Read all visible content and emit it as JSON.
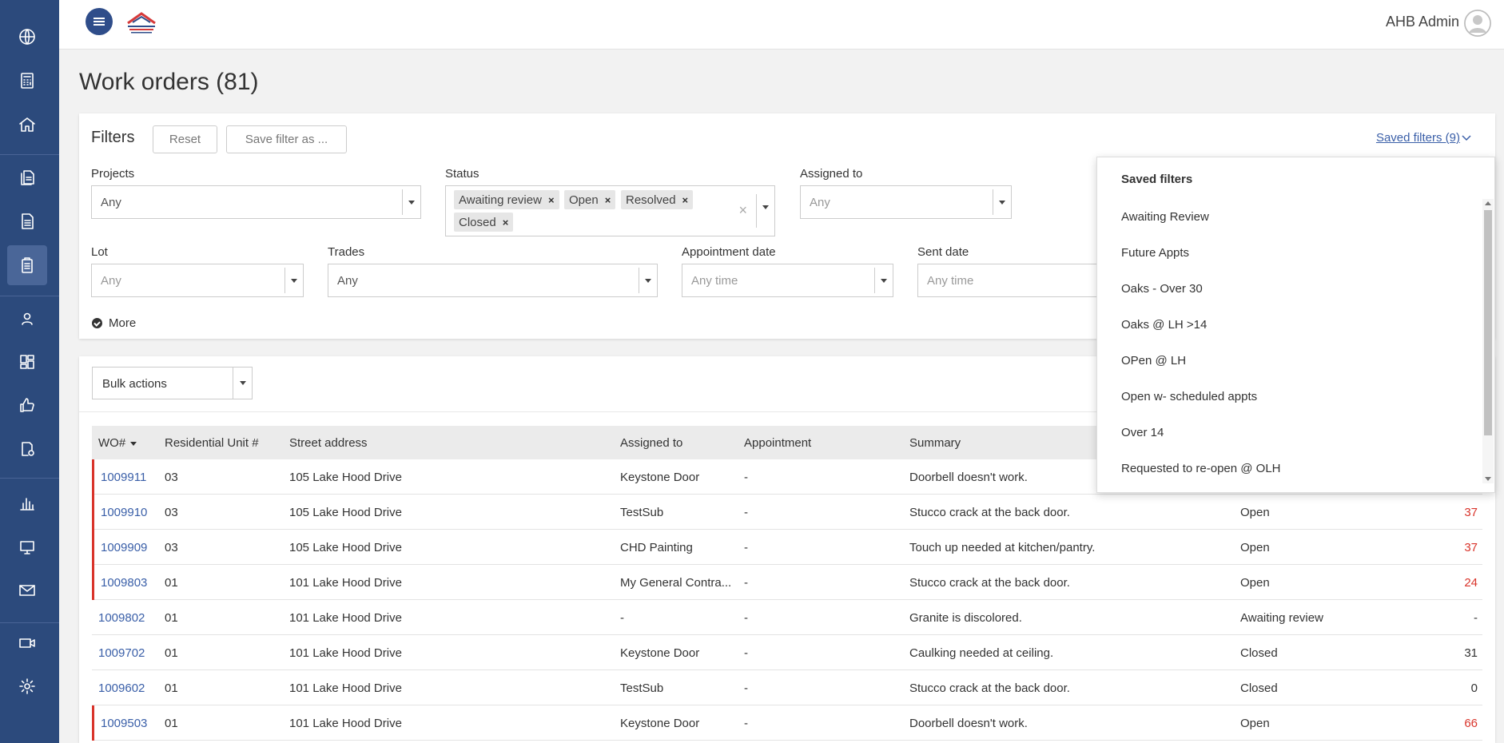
{
  "header": {
    "user_name": "AHB Admin",
    "page_title": "Work orders (81)"
  },
  "sidebar": {
    "items": [
      {
        "icon": "globe-icon"
      },
      {
        "icon": "calculator-icon"
      },
      {
        "icon": "home-icon"
      },
      {
        "icon": "documents-icon"
      },
      {
        "icon": "document-icon"
      },
      {
        "icon": "clipboard-icon",
        "active": true
      },
      {
        "icon": "person-icon"
      },
      {
        "icon": "dashboard-icon"
      },
      {
        "icon": "thumbs-up-icon"
      },
      {
        "icon": "settings-doc-icon"
      },
      {
        "icon": "bar-chart-icon"
      },
      {
        "icon": "monitor-icon"
      },
      {
        "icon": "mail-icon"
      },
      {
        "icon": "video-icon"
      },
      {
        "icon": "gear-icon"
      }
    ]
  },
  "filters": {
    "title": "Filters",
    "reset_label": "Reset",
    "save_label": "Save filter as ...",
    "saved_link": "Saved filters (9)",
    "projects": {
      "label": "Projects",
      "value": "Any"
    },
    "status": {
      "label": "Status",
      "chips": [
        "Awaiting review",
        "Open",
        "Resolved",
        "Closed"
      ]
    },
    "assigned_to": {
      "label": "Assigned to",
      "placeholder": "Any"
    },
    "lot": {
      "label": "Lot",
      "placeholder": "Any"
    },
    "trades": {
      "label": "Trades",
      "value": "Any"
    },
    "appointment_date": {
      "label": "Appointment date",
      "placeholder": "Any time"
    },
    "sent_date": {
      "label": "Sent date",
      "placeholder": "Any time"
    },
    "more_label": "More"
  },
  "table": {
    "bulk_actions": "Bulk actions",
    "columns": [
      "WO#",
      "Residential Unit #",
      "Street address",
      "Assigned to",
      "Appointment",
      "Summary"
    ],
    "rows": [
      {
        "wo": "1009911",
        "unit": "03",
        "address": "105 Lake Hood Drive",
        "assigned": "Keystone Door",
        "appt": "-",
        "summary": "Doorbell doesn't work.",
        "status": "",
        "days": "",
        "flag": true
      },
      {
        "wo": "1009910",
        "unit": "03",
        "address": "105 Lake Hood Drive",
        "assigned": "TestSub",
        "appt": "-",
        "summary": "Stucco crack at the back door.",
        "status": "Open",
        "days": "37",
        "flag": true
      },
      {
        "wo": "1009909",
        "unit": "03",
        "address": "105 Lake Hood Drive",
        "assigned": "CHD Painting",
        "appt": "-",
        "summary": "Touch up needed at kitchen/pantry.",
        "status": "Open",
        "days": "37",
        "flag": true
      },
      {
        "wo": "1009803",
        "unit": "01",
        "address": "101 Lake Hood Drive",
        "assigned": "My General Contra...",
        "appt": "-",
        "summary": "Stucco crack at the back door.",
        "status": "Open",
        "days": "24",
        "flag": true
      },
      {
        "wo": "1009802",
        "unit": "01",
        "address": "101 Lake Hood Drive",
        "assigned": "-",
        "appt": "-",
        "summary": "Granite is discolored.",
        "status": "Awaiting review",
        "days": "-",
        "flag": false
      },
      {
        "wo": "1009702",
        "unit": "01",
        "address": "101 Lake Hood Drive",
        "assigned": "Keystone Door",
        "appt": "-",
        "summary": "Caulking needed at ceiling.",
        "status": "Closed",
        "days": "31",
        "flag": false
      },
      {
        "wo": "1009602",
        "unit": "01",
        "address": "101 Lake Hood Drive",
        "assigned": "TestSub",
        "appt": "-",
        "summary": "Stucco crack at the back door.",
        "status": "Closed",
        "days": "0",
        "flag": false
      },
      {
        "wo": "1009503",
        "unit": "01",
        "address": "101 Lake Hood Drive",
        "assigned": "Keystone Door",
        "appt": "-",
        "summary": "Doorbell doesn't work.",
        "status": "Open",
        "days": "66",
        "flag": true
      }
    ]
  },
  "saved_filters": {
    "title": "Saved filters",
    "items": [
      "Awaiting Review",
      "Future Appts",
      "Oaks - Over 30",
      "Oaks @ LH >14",
      "OPen @ LH",
      "Open w- scheduled appts",
      "Over 14",
      "Requested to re-open @ OLH"
    ]
  },
  "colors": {
    "sidebar": "#2c4a7c",
    "link": "#3a5fa8",
    "alert": "#d9342b"
  }
}
